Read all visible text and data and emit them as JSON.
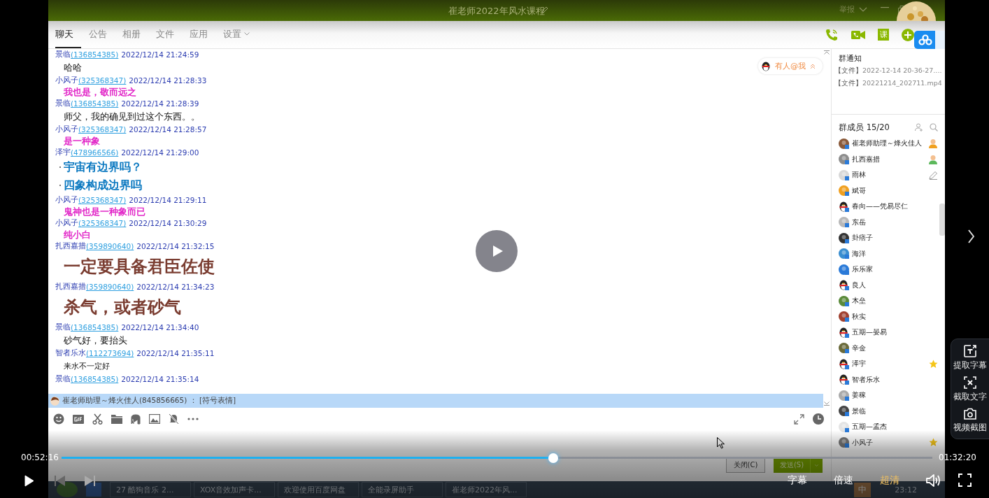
{
  "window": {
    "title": "崔老师2022年风水课程",
    "report": "举报"
  },
  "tabs": [
    {
      "label": "聊天",
      "selected": true,
      "dropdown": false
    },
    {
      "label": "公告",
      "selected": false,
      "dropdown": false
    },
    {
      "label": "相册",
      "selected": false,
      "dropdown": false
    },
    {
      "label": "文件",
      "selected": false,
      "dropdown": false
    },
    {
      "label": "应用",
      "selected": false,
      "dropdown": false
    },
    {
      "label": "设置",
      "selected": false,
      "dropdown": true
    }
  ],
  "course_badge": "课",
  "mention_badge": "有人@我",
  "messages": [
    {
      "sender": "景临",
      "qq": "(136854385)",
      "time": "2022/12/14 21:24:59",
      "kind": "plain",
      "lines": [
        "哈哈"
      ]
    },
    {
      "sender": "小风子",
      "qq": "(325368347)",
      "time": "2022/12/14 21:28:33",
      "kind": "pink",
      "lines": [
        "我也是，敬而远之"
      ]
    },
    {
      "sender": "景临",
      "qq": "(136854385)",
      "time": "2022/12/14 21:28:39",
      "kind": "plain",
      "lines": [
        "师父，我的确见到过这个东西。。"
      ]
    },
    {
      "sender": "小风子",
      "qq": "(325368347)",
      "time": "2022/12/14 21:28:57",
      "kind": "pink",
      "lines": [
        "是一种象"
      ]
    },
    {
      "sender": "泽宇",
      "qq": "(478966566)",
      "time": "2022/12/14 21:29:00",
      "kind": "blue",
      "lines": [
        "宇宙有边界吗？",
        "四象构成边界吗"
      ]
    },
    {
      "sender": "小风子",
      "qq": "(325368347)",
      "time": "2022/12/14 21:29:11",
      "kind": "pink",
      "lines": [
        "鬼神也是一种象而已"
      ]
    },
    {
      "sender": "小风子",
      "qq": "(325368347)",
      "time": "2022/12/14 21:30:29",
      "kind": "pink",
      "lines": [
        "纯小白"
      ]
    },
    {
      "sender": "扎西嘉措",
      "qq": "(359890640)",
      "time": "2022/12/14 21:32:15",
      "kind": "brown",
      "lines": [
        "一定要具备君臣佐使"
      ]
    },
    {
      "sender": "扎西嘉措",
      "qq": "(359890640)",
      "time": "2022/12/14 21:34:23",
      "kind": "brown",
      "lines": [
        "杀气，或者砂气"
      ]
    },
    {
      "sender": "景临",
      "qq": "(136854385)",
      "time": "2022/12/14 21:34:40",
      "kind": "plain",
      "lines": [
        "砂气好，要抬头"
      ]
    },
    {
      "sender": "智者乐水",
      "qq": "(112273694)",
      "time": "2022/12/14 21:35:11",
      "kind": "small",
      "lines": [
        "来水不一定好"
      ]
    },
    {
      "sender": "景临",
      "qq": "(136854385)",
      "time": "2022/12/14 21:35:14"
    }
  ],
  "quote_bar": "崔老师助理～烽火佳人(845856665) ： [符号表情]",
  "buttons": [
    "关闭(C)",
    "发送(S)"
  ],
  "notice": {
    "title": "群通知",
    "items": [
      {
        "tag": "【文件】",
        "text": "2022-12-14 20-36-27...."
      },
      {
        "tag": "【文件】",
        "text": "20221214_202711.mp4"
      }
    ]
  },
  "members": {
    "title": "群成员 15/20",
    "list": [
      {
        "name": "崔老师助理～烽火佳人",
        "color": "#8a5a3a",
        "owner": true,
        "admin": false,
        "hovered": false,
        "starred": false
      },
      {
        "name": "扎西嘉措",
        "color": "#8c8c8c",
        "owner": false,
        "admin": true,
        "hovered": false,
        "starred": false
      },
      {
        "name": "雨林",
        "color": "#d8d8d8",
        "owner": false,
        "admin": false,
        "hovered": true,
        "starred": false
      },
      {
        "name": "斌哥",
        "color": "#f0a020",
        "owner": false,
        "admin": false,
        "hovered": false,
        "starred": false
      },
      {
        "name": "春向——凭易尽仁",
        "kind": "penguin",
        "owner": false,
        "admin": false,
        "hovered": false,
        "starred": false
      },
      {
        "name": "东岳",
        "color": "#b8b8b8",
        "owner": false,
        "admin": false,
        "hovered": false,
        "starred": false
      },
      {
        "name": "卦痞子",
        "color": "#333333",
        "owner": false,
        "admin": false,
        "hovered": false,
        "starred": false
      },
      {
        "name": "海洋",
        "color": "#3a8ed0",
        "owner": false,
        "admin": false,
        "hovered": false,
        "starred": false
      },
      {
        "name": "乐乐家",
        "color": "#2a7ad8",
        "owner": false,
        "admin": false,
        "hovered": false,
        "starred": false
      },
      {
        "name": "良人",
        "kind": "penguin",
        "owner": false,
        "admin": false,
        "hovered": false,
        "starred": false
      },
      {
        "name": "木垒",
        "color": "#5a8a3a",
        "owner": false,
        "admin": false,
        "hovered": false,
        "starred": false
      },
      {
        "name": "秋实",
        "color": "#a04030",
        "owner": false,
        "admin": false,
        "hovered": false,
        "starred": false
      },
      {
        "name": "五期—晏易",
        "kind": "penguin",
        "owner": false,
        "admin": false,
        "hovered": false,
        "starred": false
      },
      {
        "name": "辛金",
        "color": "#6a6a3a",
        "owner": false,
        "admin": false,
        "hovered": false,
        "starred": false
      },
      {
        "name": "泽宇",
        "kind": "penguin",
        "owner": false,
        "admin": false,
        "hovered": false,
        "starred": true
      },
      {
        "name": "智者乐水",
        "kind": "penguin",
        "owner": false,
        "admin": false,
        "hovered": false,
        "starred": false
      },
      {
        "name": "姜稼",
        "color": "#aaaaaa",
        "owner": false,
        "admin": false,
        "hovered": false,
        "starred": false
      },
      {
        "name": "景临",
        "color": "#444444",
        "owner": false,
        "admin": false,
        "hovered": false,
        "starred": false
      },
      {
        "name": "五期—孟杰",
        "color": "#e4e4e4",
        "owner": false,
        "admin": false,
        "hovered": false,
        "starred": false
      },
      {
        "name": "小风子",
        "color": "#777777",
        "owner": false,
        "admin": false,
        "hovered": false,
        "starred": true
      }
    ]
  },
  "taskbar": {
    "items": [
      "27 酷狗音乐 2...",
      "XOX音效加声卡...",
      "欢迎使用百度网盘",
      "全能录屏助手",
      "崔老师2022年风..."
    ],
    "clock": "23:12",
    "ime": "中"
  },
  "player": {
    "current": "00:52:16",
    "total": "01:32:20",
    "level": 0.565,
    "options": [
      {
        "label": "字幕",
        "active": false
      },
      {
        "label": "倍速",
        "active": false
      },
      {
        "label": "超清",
        "active": true
      }
    ],
    "tools": [
      {
        "kind": "subtitle",
        "label": "提取字幕"
      },
      {
        "kind": "ocr",
        "label": "截取文字"
      },
      {
        "kind": "screenshot",
        "label": "视频截图"
      }
    ]
  }
}
